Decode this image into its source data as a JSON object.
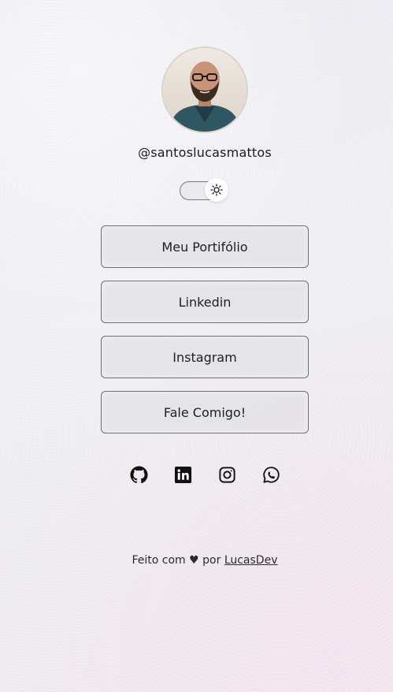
{
  "profile": {
    "username": "@santoslucasmattos",
    "avatar_icon": "profile-photo"
  },
  "theme_toggle": {
    "icon": "sun-icon",
    "state": "light"
  },
  "links": [
    {
      "label": "Meu Portifólio"
    },
    {
      "label": "Linkedin"
    },
    {
      "label": "Instagram"
    },
    {
      "label": "Fale Comigo!"
    }
  ],
  "socials": [
    {
      "icon": "github-icon"
    },
    {
      "icon": "linkedin-icon"
    },
    {
      "icon": "instagram-icon"
    },
    {
      "icon": "whatsapp-icon"
    }
  ],
  "footer": {
    "prefix": "Feito com ",
    "heart": "♥",
    "middle": " por ",
    "author": "LucasDev"
  }
}
